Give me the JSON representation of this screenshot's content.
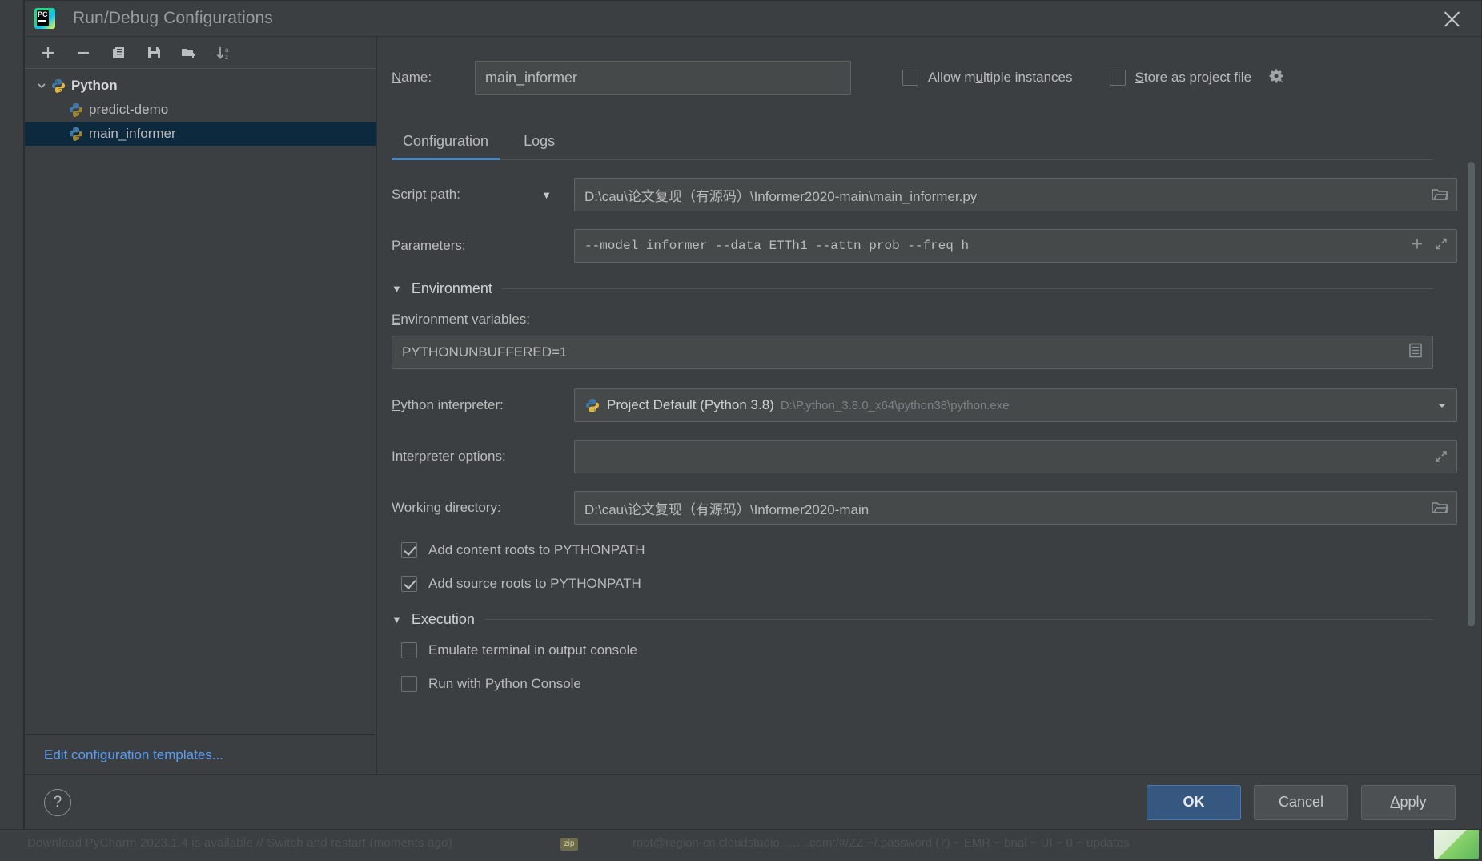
{
  "window": {
    "title": "Run/Debug Configurations",
    "logo_icon": "pycharm-logo-icon",
    "close_icon": "close-icon"
  },
  "left_panel": {
    "toolbar": [
      {
        "name": "add-configuration-button",
        "icon": "plus-icon"
      },
      {
        "name": "remove-configuration-button",
        "icon": "minus-icon"
      },
      {
        "name": "copy-configuration-button",
        "icon": "copy-icon"
      },
      {
        "name": "save-configuration-button",
        "icon": "save-icon"
      },
      {
        "name": "move-into-folder-button",
        "icon": "new-folder-icon"
      },
      {
        "name": "sort-configurations-button",
        "icon": "sort-az-icon"
      }
    ],
    "tree": [
      {
        "label": "Python",
        "type": "group",
        "expanded": true,
        "icon": "python-icon",
        "selected": false
      },
      {
        "label": "predict-demo",
        "type": "item",
        "icon": "python-icon",
        "selected": false
      },
      {
        "label": "main_informer",
        "type": "item",
        "icon": "python-icon",
        "selected": true
      }
    ],
    "edit_templates_link": "Edit configuration templates..."
  },
  "header": {
    "name_label": "Name:",
    "name_mnemonic": "N",
    "name_value": "main_informer",
    "allow_multiple": {
      "label": "Allow multiple instances",
      "mnemonic": "u",
      "checked": false
    },
    "store_as_project_file": {
      "label": "Store as project file",
      "mnemonic": "S",
      "checked": false,
      "gear_icon": "gear-dropdown-icon"
    }
  },
  "tabs": [
    {
      "label": "Configuration",
      "active": true
    },
    {
      "label": "Logs",
      "active": false
    }
  ],
  "form": {
    "script_path": {
      "label": "Script path:",
      "value": "D:\\cau\\论文复现（有源码）\\Informer2020-main\\main_informer.py",
      "dropdown_icon": "chevron-down-icon",
      "browse_icon": "folder-browse-icon"
    },
    "parameters": {
      "label": "Parameters:",
      "mnemonic": "P",
      "value": "--model informer --data ETTh1 --attn prob --freq h",
      "add_icon": "plus-icon",
      "expand_icon": "expand-editor-icon"
    },
    "environment_section": {
      "title": "Environment",
      "expanded": true,
      "collapse_icon": "triangle-down-icon"
    },
    "environment_variables": {
      "label": "Environment variables:",
      "mnemonic": "E",
      "value": "PYTHONUNBUFFERED=1",
      "browse_icon": "env-list-icon"
    },
    "python_interpreter": {
      "label": "Python interpreter:",
      "mnemonic": "P",
      "icon": "python-icon",
      "value": "Project Default (Python 3.8)",
      "path_hint": "D:\\P.ython_3.8.0_x64\\python38\\python.exe",
      "dropdown_icon": "chevron-down-icon"
    },
    "interpreter_options": {
      "label": "Interpreter options:",
      "value": "",
      "expand_icon": "expand-editor-icon"
    },
    "working_directory": {
      "label": "Working directory:",
      "mnemonic": "W",
      "value": "D:\\cau\\论文复现（有源码）\\Informer2020-main",
      "browse_icon": "folder-browse-icon"
    },
    "add_content_roots": {
      "label": "Add content roots to PYTHONPATH",
      "checked": true
    },
    "add_source_roots": {
      "label": "Add source roots to PYTHONPATH",
      "checked": true
    },
    "execution_section": {
      "title": "Execution",
      "expanded": true,
      "collapse_icon": "triangle-down-icon"
    },
    "emulate_terminal": {
      "label": "Emulate terminal in output console",
      "checked": false
    },
    "run_with_python_console": {
      "label": "Run with Python Console",
      "checked": false
    }
  },
  "footer": {
    "help_icon": "help-icon",
    "ok_label": "OK",
    "cancel_label": "Cancel",
    "apply_label": "Apply",
    "apply_mnemonic": "A"
  },
  "background": {
    "status_text": "Download PyCharm 2023.1.4 is available // Switch and restart (moments ago)",
    "status_text2": "root@region-cn.cloudstudio.........com:/#/ZZ ~/.password (7) ~ EMR ~ bnal ~ UI ~ 0 ~ updates",
    "chip": "zip"
  },
  "colors": {
    "accent": "#4a88c7",
    "primary_button": "#365880",
    "selection": "#0d293e",
    "link": "#589df6",
    "panel": "#3c3f41",
    "field": "#45494a"
  }
}
